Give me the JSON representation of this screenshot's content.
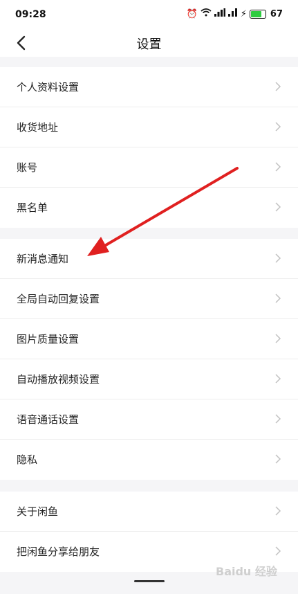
{
  "status": {
    "time": "09:28",
    "battery": "67"
  },
  "nav": {
    "title": "设置"
  },
  "groups": [
    {
      "items": [
        "个人资料设置",
        "收货地址",
        "账号",
        "黑名单"
      ]
    },
    {
      "items": [
        "新消息通知",
        "全局自动回复设置",
        "图片质量设置",
        "自动播放视频设置",
        "语音通话设置",
        "隐私"
      ]
    },
    {
      "items": [
        "关于闲鱼",
        "把闲鱼分享给朋友"
      ]
    }
  ],
  "watermark": "Baidu 经验",
  "colors": {
    "arrow": "#e02020",
    "background": "#f5f5f7",
    "text": "#222222"
  }
}
